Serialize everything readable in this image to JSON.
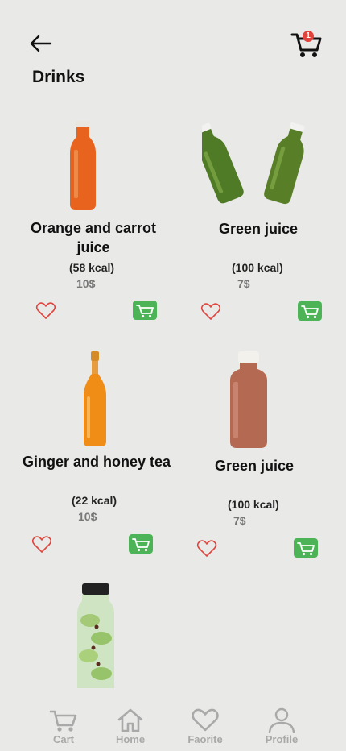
{
  "header": {
    "title": "Drinks",
    "cart_count": "1",
    "back_icon": "arrow-left-icon",
    "cart_icon": "cart-icon"
  },
  "products": [
    {
      "name": "Orange and carrot juice",
      "kcal": "(58 kcal)",
      "price": "10$",
      "image": "orange-carrot-bottle"
    },
    {
      "name": "Green juice",
      "kcal": "(100 kcal)",
      "price": "7$",
      "image": "green-juice-bottles"
    },
    {
      "name": "Ginger and honey tea",
      "kcal": "(22 kcal)",
      "price": "10$",
      "image": "ginger-honey-bottle"
    },
    {
      "name": "Green juice",
      "kcal": "(100 kcal)",
      "price": "7$",
      "image": "brown-juice-bottle"
    },
    {
      "name": "",
      "kcal": "",
      "price": "",
      "image": "cucumber-water-bottle"
    }
  ],
  "tabs": [
    {
      "label": "Cart",
      "icon": "cart-icon"
    },
    {
      "label": "Home",
      "icon": "home-icon"
    },
    {
      "label": "Faorite",
      "icon": "heart-icon"
    },
    {
      "label": "Profile",
      "icon": "person-icon"
    }
  ],
  "colors": {
    "background": "#e9e9e7",
    "accent_green": "#4cb457",
    "heart_red": "#e0443c",
    "tab_gray": "#a9a9a9"
  }
}
